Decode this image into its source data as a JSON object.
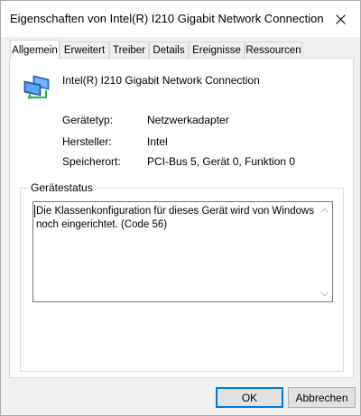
{
  "window": {
    "title": "Eigenschaften von Intel(R) I210 Gigabit Network Connection"
  },
  "tabs": [
    {
      "label": "Allgemein",
      "active": true
    },
    {
      "label": "Erweitert",
      "active": false
    },
    {
      "label": "Treiber",
      "active": false
    },
    {
      "label": "Details",
      "active": false
    },
    {
      "label": "Ereignisse",
      "active": false
    },
    {
      "label": "Ressourcen",
      "active": false
    }
  ],
  "device": {
    "name": "Intel(R) I210 Gigabit Network Connection",
    "icon": "network-adapter-icon"
  },
  "properties": [
    {
      "label": "Gerätetyp:",
      "value": "Netzwerkadapter"
    },
    {
      "label": "Hersteller:",
      "value": "Intel"
    },
    {
      "label": "Speicherort:",
      "value": "PCI-Bus 5, Gerät 0, Funktion 0"
    }
  ],
  "status": {
    "group_label": "Gerätestatus",
    "text": "Die Klassenkonfiguration für dieses Gerät wird von Windows noch eingerichtet. (Code 56)"
  },
  "buttons": {
    "ok": "OK",
    "cancel": "Abbrechen"
  },
  "colors": {
    "accent": "#0078d7",
    "window_bg": "#f0f0f0",
    "panel_bg": "#ffffff"
  }
}
